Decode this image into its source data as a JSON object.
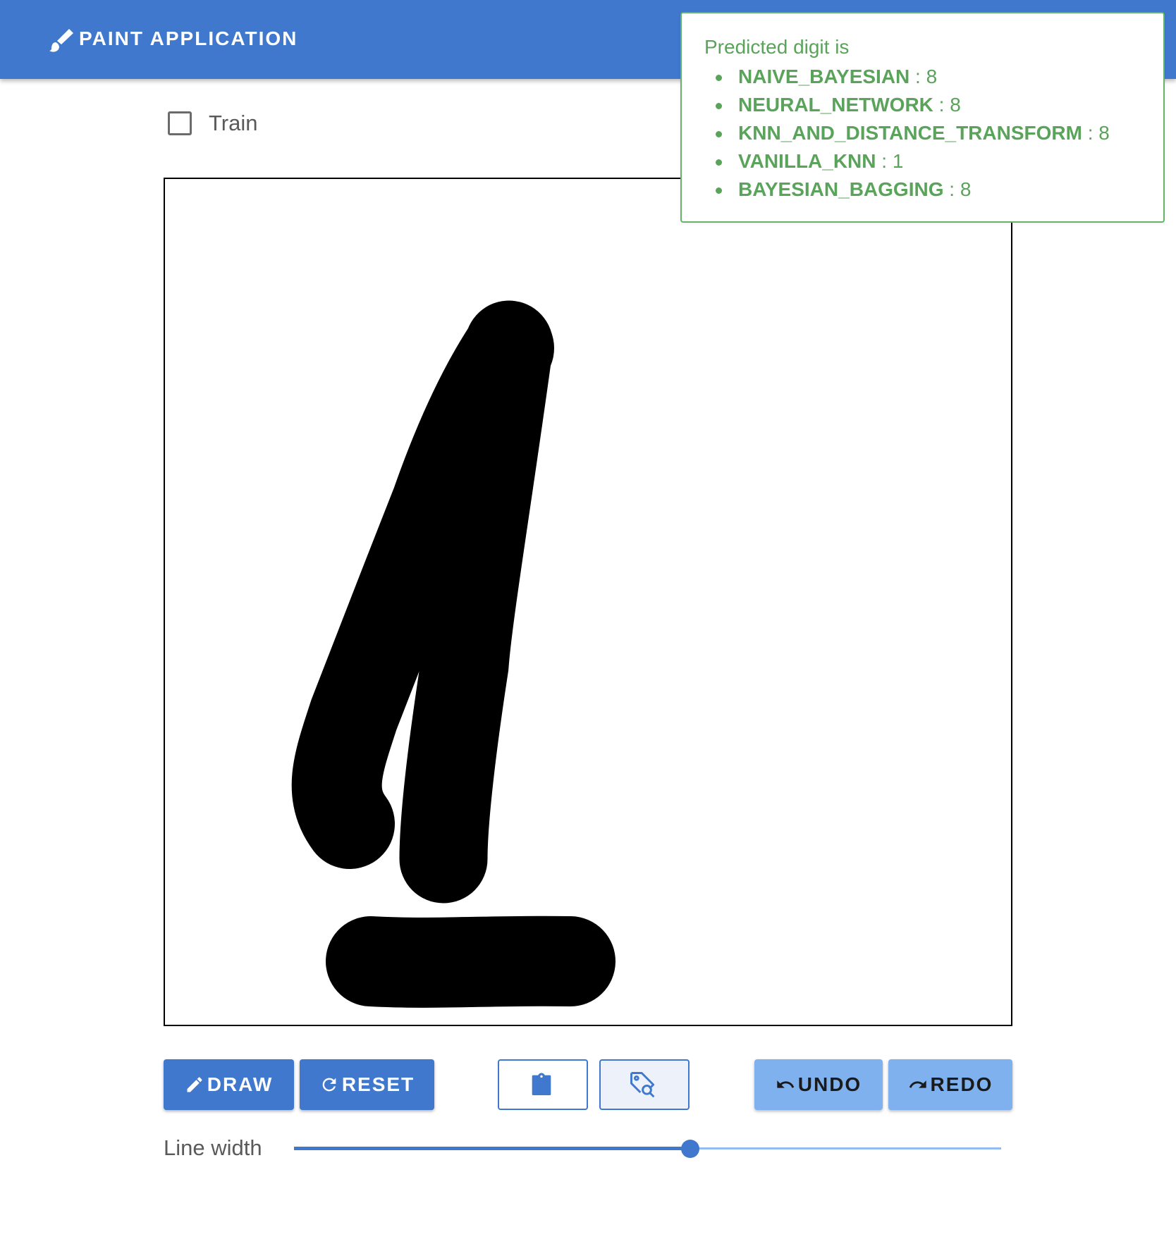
{
  "app": {
    "title": "PAINT APPLICATION",
    "brand_icon": "paintbrush-icon",
    "accent_color": "#3f78cd",
    "success_color": "#5aa35a"
  },
  "train": {
    "label": "Train",
    "checked": false
  },
  "prediction": {
    "title": "Predicted digit is",
    "results": [
      {
        "model": "NAIVE_BAYESIAN",
        "separator": " : ",
        "digit": "8"
      },
      {
        "model": "NEURAL_NETWORK",
        "separator": " : ",
        "digit": "8"
      },
      {
        "model": "KNN_AND_DISTANCE_TRANSFORM",
        "separator": " : ",
        "digit": "8"
      },
      {
        "model": "VANILLA_KNN",
        "separator": " : ",
        "digit": "1"
      },
      {
        "model": "BAYESIAN_BAGGING",
        "separator": " : ",
        "digit": "8"
      }
    ]
  },
  "toolbar": {
    "draw_label": "DRAW",
    "draw_icon": "pencil-icon",
    "reset_label": "RESET",
    "reset_icon": "refresh-icon",
    "clipboard_icon": "clipboard-icon",
    "tag_search_icon": "tag-search-icon",
    "undo_label": "UNDO",
    "undo_icon": "undo-icon",
    "redo_label": "REDO",
    "redo_icon": "redo-icon"
  },
  "line_width": {
    "label": "Line width",
    "value_fraction": 0.56
  }
}
